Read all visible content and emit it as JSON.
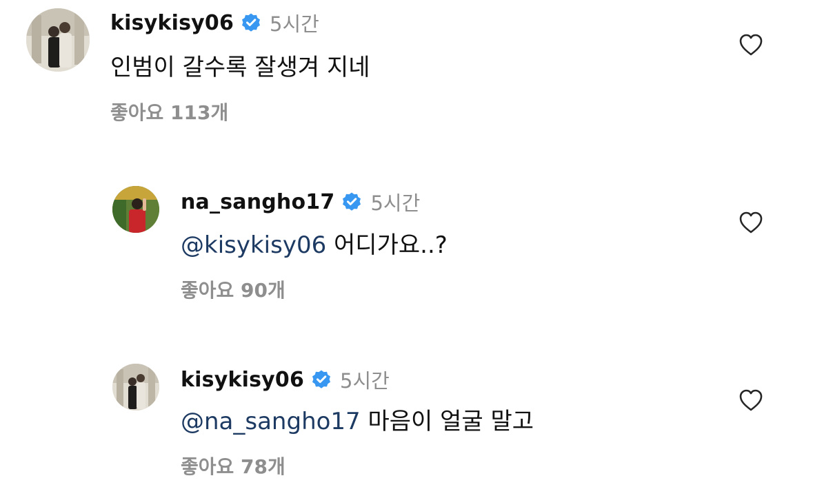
{
  "comments": [
    {
      "username": "kisykisy06",
      "verified": true,
      "time": "5시간",
      "mention": "",
      "text": "인범이 갈수록 잘생겨 지네",
      "likes": "좋아요 113개",
      "avatar_icon": "user-photo"
    },
    {
      "username": "na_sangho17",
      "verified": true,
      "time": "5시간",
      "mention": "@kisykisy06",
      "text": "어디가요..?",
      "likes": "좋아요 90개",
      "avatar_icon": "user-photo"
    },
    {
      "username": "kisykisy06",
      "verified": true,
      "time": "5시간",
      "mention": "@na_sangho17",
      "text": "마음이 얼굴 말고",
      "likes": "좋아요 78개",
      "avatar_icon": "user-photo"
    }
  ],
  "icons": {
    "like": "heart-outline-icon",
    "verified": "verified-badge-icon"
  },
  "colors": {
    "verified_blue": "#3897f0",
    "mention": "#1d3a63",
    "secondary_text": "#8e8e8e"
  }
}
